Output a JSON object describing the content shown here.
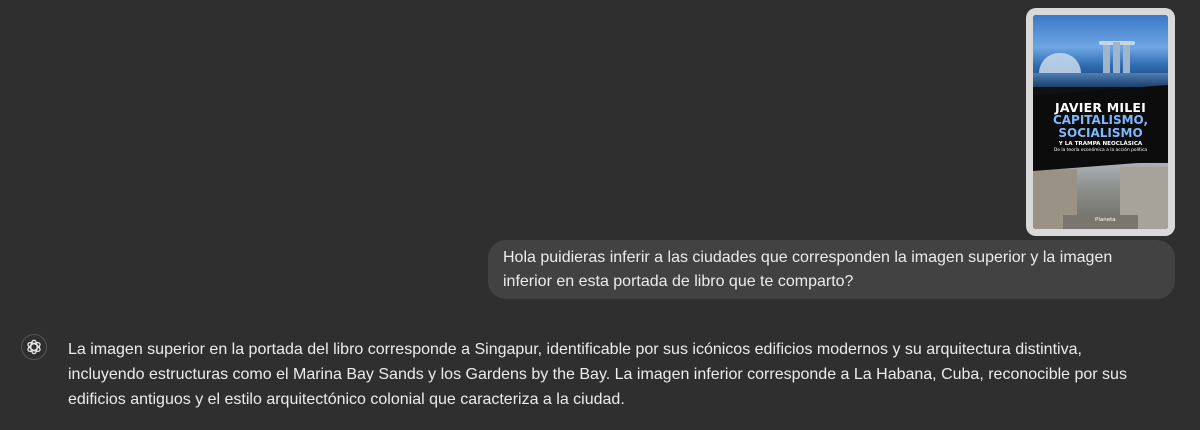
{
  "attachment": {
    "cover": {
      "author": "JAVIER MILEI",
      "title_line1": "CAPITALISMO,",
      "title_line2": "SOCIALISMO",
      "subtitle": "Y LA TRAMPA NEOCLÁSICA",
      "tagline": "De la teoría económica a la acción política",
      "publisher": "Planeta"
    }
  },
  "user_message": {
    "text": "Hola puidieras inferir a las ciudades que corresponden la imagen superior y la imagen inferior en esta portada de libro que te comparto?"
  },
  "assistant_message": {
    "avatar_icon": "openai-logo-icon",
    "text": "La imagen superior en la portada del libro corresponde a Singapur, identificable por sus icónicos edificios modernos y su arquitectura distintiva, incluyendo estructuras como el Marina Bay Sands y los Gardens by the Bay. La imagen inferior corresponde a La Habana, Cuba, reconocible por sus edificios antiguos y el estilo arquitectónico colonial que caracteriza a la ciudad."
  },
  "colors": {
    "background": "#2f2f2f",
    "user_bubble": "#424242",
    "text": "#ececec",
    "cover_title_blue": "#7fb8ff"
  }
}
